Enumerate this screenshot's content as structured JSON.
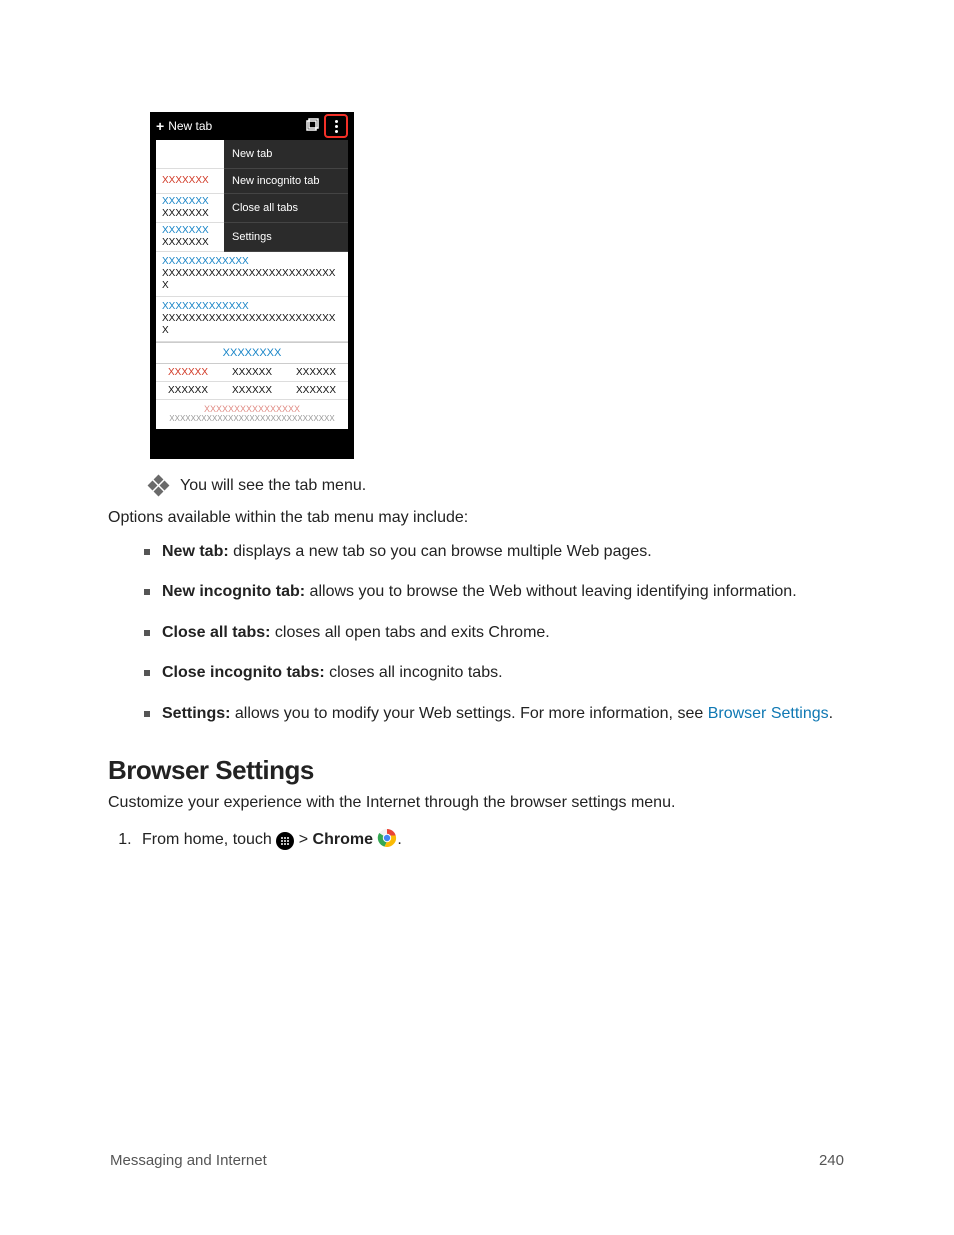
{
  "phone": {
    "topbar_label": "New tab",
    "menu": [
      "New tab",
      "New incognito tab",
      "Close all tabs",
      "Settings"
    ],
    "left_red_1": "XXXXXXX",
    "left_blue_2": "XXXXXXX",
    "left_black_2": "XXXXXXX",
    "left_blue_3": "XXXXXXX",
    "left_black_3": "XXXXXXX",
    "wide_title": "XXXXXXXXXXXXX",
    "wide_sub": "XXXXXXXXXXXXXXXXXXXXXXXXXXX",
    "wide_title2": "XXXXXXXXXXXXX",
    "wide_sub2": "XXXXXXXXXXXXXXXXXXXXXXXXXXX",
    "section": "XXXXXXXX",
    "triple": [
      "XXXXXX",
      "XXXXXX",
      "XXXXXX"
    ],
    "bottom_pink": "XXXXXXXXXXXXXXXX",
    "bottom_muted": "XXXXXXXXXXXXXXXXXXXXXXXXXXXXXXX"
  },
  "result_text": "You will see the tab menu.",
  "options_intro": "Options available within the tab menu may include:",
  "options": [
    {
      "label": "New tab:",
      "desc": " displays a new tab so you can browse multiple Web pages."
    },
    {
      "label": "New incognito tab:",
      "desc": " allows you to browse the Web without leaving identifying information."
    },
    {
      "label": "Close all tabs:",
      "desc": " closes all open tabs and exits Chrome."
    },
    {
      "label": "Close incognito tabs:",
      "desc": " closes all incognito tabs."
    },
    {
      "label": "Settings:",
      "desc": " allows you to modify your Web settings. For more information, see ",
      "link": "Browser Settings",
      "tail": "."
    }
  ],
  "heading": "Browser Settings",
  "subhead": "Customize your experience with the Internet through the browser settings menu.",
  "step1_a": "From home, touch ",
  "step1_b": " > ",
  "step1_chrome": "Chrome",
  "step1_tail": ".",
  "footer_left": "Messaging and Internet",
  "footer_right": "240"
}
